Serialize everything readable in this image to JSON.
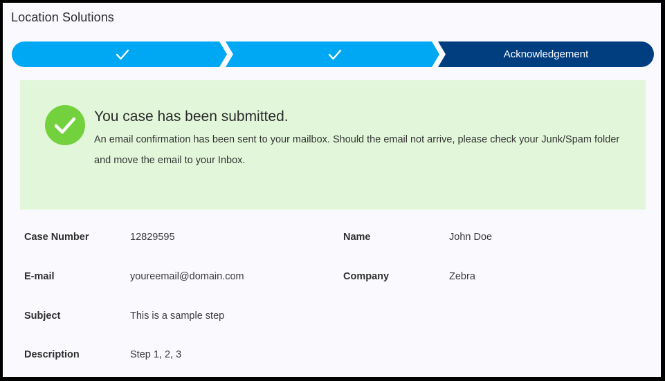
{
  "page": {
    "title": "Location Solutions"
  },
  "stepper": {
    "steps": [
      {
        "label": "",
        "state": "completed",
        "icon": "checkmark-icon"
      },
      {
        "label": "",
        "state": "completed",
        "icon": "checkmark-icon"
      },
      {
        "label": "Acknowledgement",
        "state": "active"
      }
    ],
    "colors": {
      "completed": "#00a8f3",
      "active": "#003e80"
    }
  },
  "confirmation": {
    "icon": "check-circle-icon",
    "icon_color": "#73d13d",
    "background": "#e2f7da",
    "heading": "You case has been submitted.",
    "message": "An email confirmation has been sent to your mailbox. Should the email not arrive, please check your Junk/Spam folder and move the email to your Inbox."
  },
  "details": {
    "case_number": {
      "label": "Case Number",
      "value": "12829595"
    },
    "name": {
      "label": "Name",
      "value": "John Doe"
    },
    "email": {
      "label": "E-mail",
      "value": "youreemail@domain.com"
    },
    "company": {
      "label": "Company",
      "value": "Zebra"
    },
    "subject": {
      "label": "Subject",
      "value": "This is a sample step"
    },
    "description": {
      "label": "Description",
      "value": "Step 1, 2, 3"
    }
  }
}
